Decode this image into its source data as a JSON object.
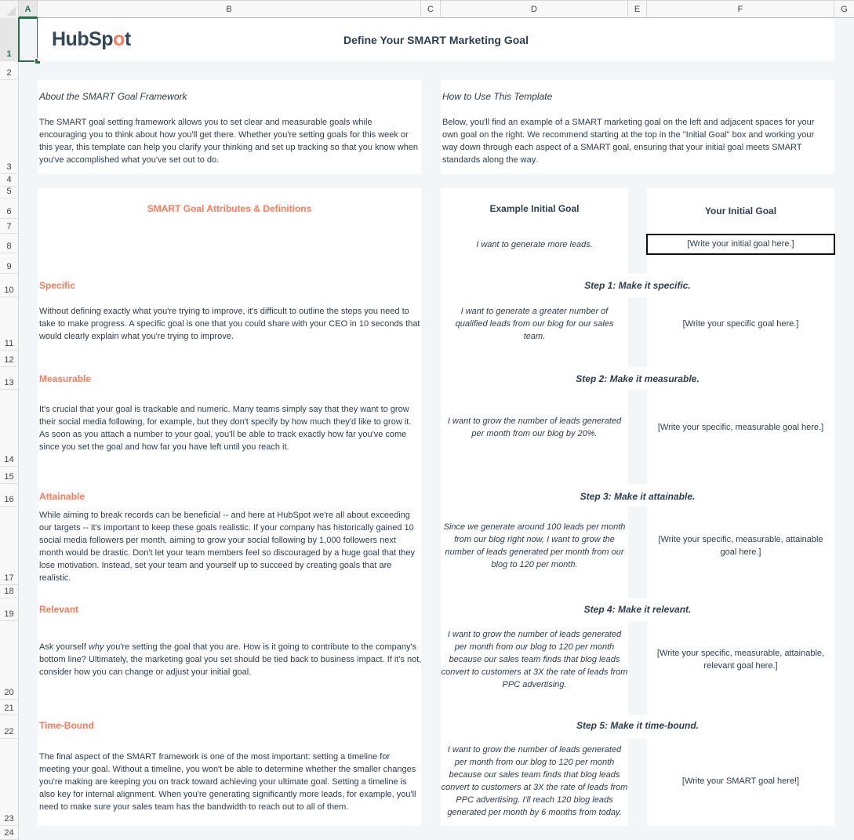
{
  "spreadsheet": {
    "columns": [
      "A",
      "B",
      "C",
      "D",
      "E",
      "F",
      "G"
    ],
    "selected_column": "A",
    "rows": [
      "1",
      "2",
      "3",
      "4",
      "5",
      "6",
      "7",
      "8",
      "9",
      "10",
      "11",
      "12",
      "13",
      "14",
      "15",
      "16",
      "17",
      "18",
      "19",
      "20",
      "21",
      "22",
      "23",
      "24"
    ],
    "selected_cell": "A1"
  },
  "header": {
    "logo_text_1": "HubSp",
    "logo_text_2": "o",
    "logo_text_3": "t",
    "title": "Define Your SMART Marketing Goal"
  },
  "about": {
    "heading": "About the SMART Goal Framework",
    "body": "The SMART goal setting framework allows you to set clear and measurable goals while encouraging you to think about how you'll get there. Whether you're setting goals for this week or this year, this template can help you clarify your thinking and set up tracking so that you know when you've accomplished what you've set out to do."
  },
  "howto": {
    "heading": "How to Use This Template",
    "body": "Below, you'll find an example of a SMART marketing goal on the left and adjacent spaces for your own goal on the right. We recommend starting at the top in the \"Initial Goal\" box and working your way down through each aspect of a SMART goal, ensuring that your initial goal meets SMART standards along the way."
  },
  "definitions": {
    "heading": "SMART Goal Attributes & Definitions",
    "items": [
      {
        "title": "Specific",
        "body": "Without defining exactly what you're trying to improve, it's difficult to outline the steps you need to take to make progress. A specific goal is one that you could share with your CEO in 10 seconds that would clearly explain what you're trying to improve."
      },
      {
        "title": "Measurable",
        "body": "It's crucial that your goal is trackable and numeric. Many teams simply say that they want to grow their social media following, for example, but they don't specify by how much they'd like to grow it. As soon as you attach a number to your goal, you'll be able to track exactly how far you've come since you set the goal and how far you have left until you reach it."
      },
      {
        "title": "Attainable",
        "body": "While aiming to break records can be beneficial -- and here at HubSpot we're all about exceeding our targets -- it's important to keep these goals realistic. If your company has historically gained 10 social media followers per month, aiming to grow your social following by 1,000 followers next month would be drastic. Don't let your team members feel so discouraged by a huge goal that they lose motivation. Instead, set your team and yourself up to succeed by creating goals that are realistic."
      },
      {
        "title": "Relevant",
        "body_pre": "Ask yourself ",
        "body_em": "why",
        "body_post": "  you're setting the goal that you are. How is it going to contribute to the company's bottom line? Ultimately, the marketing goal you set should be tied back to business impact. If it's not, consider how you can change or adjust your initial goal."
      },
      {
        "title": "Time-Bound",
        "body": "The final aspect of the SMART framework is one of the most important: setting a timeline for meeting your goal. Without a timeline, you won't be able to determine whether the smaller changes you're making are keeping you on track toward achieving your ultimate goal. Setting a timeline is also key for internal alignment. When you're generating significantly more leads, for example, you'll need to make sure your sales team has the bandwidth to reach out to all of them."
      }
    ]
  },
  "goals": {
    "example_heading": "Example Initial Goal",
    "yours_heading": "Your Initial Goal",
    "example_initial": "I want to generate more leads.",
    "your_initial_placeholder": "[Write your initial goal here.]",
    "steps": [
      {
        "label": "Step 1: Make it specific.",
        "example": "I want to generate a greater number of qualified leads from our blog for our sales team.",
        "placeholder": "[Write your specific goal here.]"
      },
      {
        "label": "Step 2: Make it measurable.",
        "example": "I want to grow the number of leads generated per month from our blog by 20%.",
        "placeholder": "[Write your specific, measurable goal here.]"
      },
      {
        "label": "Step 3: Make it attainable.",
        "example": "Since we generate around 100 leads per month from our blog right now, I want to grow the number of leads generated per month from our blog to 120 per month.",
        "placeholder": "[Write your specific, measurable, attainable goal here.]"
      },
      {
        "label": "Step 4: Make it relevant.",
        "example": "I want to grow the number of leads generated per month from our blog to 120 per month because our sales team finds that blog leads convert to customers at 3X the rate of leads from PPC advertising.",
        "placeholder": "[Write your specific, measurable, attainable, relevant goal here.]"
      },
      {
        "label": "Step 5: Make it time-bound.",
        "example": "I want to grow the number of leads generated per month from our blog to 120 per month because our sales team finds that blog leads convert to customers at 3X the rate of leads from PPC advertising. I'll reach 120 blog leads generated per month by 6 months from today.",
        "placeholder": "[Write your SMART goal here!]"
      }
    ]
  },
  "colors": {
    "accent": "#ff7a59",
    "text": "#2d3e50",
    "background": "#f3f6f9",
    "selection": "#217346"
  }
}
